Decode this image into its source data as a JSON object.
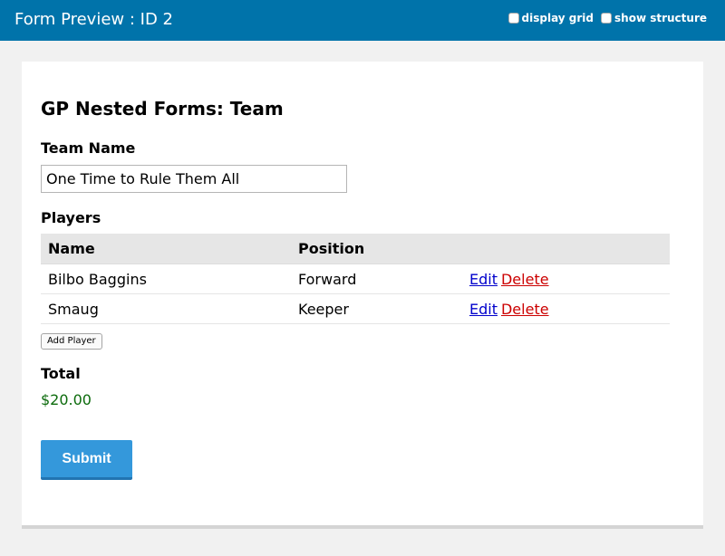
{
  "topbar": {
    "title": "Form Preview : ID 2",
    "options": [
      "display grid",
      "show structure"
    ]
  },
  "form": {
    "title": "GP Nested Forms: Team",
    "team_name_label": "Team Name",
    "team_name_value": "One Time to Rule Them All",
    "players_label": "Players",
    "players_table": {
      "headers": [
        "Name",
        "Position",
        ""
      ],
      "rows": [
        {
          "name": "Bilbo Baggins",
          "position": "Forward",
          "edit": "Edit",
          "delete": "Delete"
        },
        {
          "name": "Smaug",
          "position": "Keeper",
          "edit": "Edit",
          "delete": "Delete"
        }
      ]
    },
    "add_player_label": "Add Player",
    "total_label": "Total",
    "total_value": "$20.00",
    "submit_label": "Submit"
  },
  "colors": {
    "topbar_bg": "#0073aa",
    "submit_bg": "#3498db",
    "total_text": "#0c6b0c",
    "edit_link": "#0000cc",
    "delete_link": "#cc0000"
  }
}
